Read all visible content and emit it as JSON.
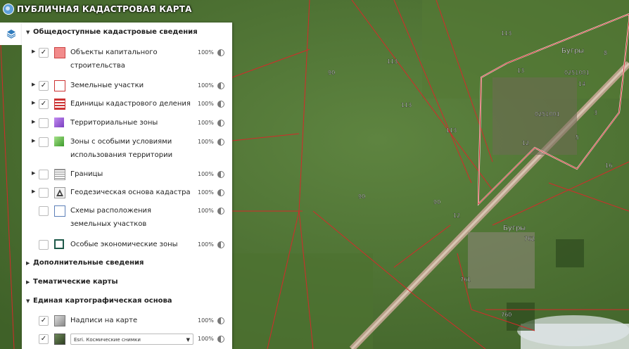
{
  "app": {
    "title": "ПУБЛИЧНАЯ КАДАСТРОВАЯ КАРТА"
  },
  "toolbar": {
    "layers_icon": "layers-icon"
  },
  "panel": {
    "section_main": "Общедоступные кадастровые сведения",
    "layers": [
      {
        "label": "Объекты капитального строительства",
        "checked": true,
        "expandable": true,
        "opacity": "100%"
      },
      {
        "label": "Земельные участки",
        "checked": true,
        "expandable": true,
        "opacity": "100%"
      },
      {
        "label": "Единицы кадастрового деления",
        "checked": true,
        "expandable": true,
        "opacity": "100%"
      },
      {
        "label": "Территориальные зоны",
        "checked": false,
        "expandable": true,
        "opacity": "100%"
      },
      {
        "label": "Зоны с особыми условиями использования территории",
        "checked": false,
        "expandable": true,
        "opacity": "100%"
      },
      {
        "label": "Границы",
        "checked": false,
        "expandable": true,
        "opacity": "100%"
      },
      {
        "label": "Геодезическая основа кадастра",
        "checked": false,
        "expandable": true,
        "opacity": "100%"
      },
      {
        "label": "Схемы расположения земельных участков",
        "checked": false,
        "expandable": false,
        "opacity": "100%"
      },
      {
        "label": "Особые экономические зоны",
        "checked": false,
        "expandable": false,
        "opacity": "100%"
      }
    ],
    "section_extra": "Дополнительные сведения",
    "section_thematic": "Тематические карты",
    "section_base": "Единая картографическая основа",
    "base_layers": [
      {
        "label": "Надписи на карте",
        "checked": true,
        "opacity": "100%"
      },
      {
        "select_value": "Esri. Космические снимки",
        "checked": true,
        "opacity": "100%"
      }
    ]
  },
  "map": {
    "labels": [
      {
        "text": "113"
      },
      {
        "text": "113"
      },
      {
        "text": "90"
      },
      {
        "text": "113"
      },
      {
        "text": "113"
      },
      {
        "text": "90"
      },
      {
        "text": "90"
      },
      {
        "text": "12"
      },
      {
        "text": "Бугры"
      },
      {
        "text": "0251001"
      },
      {
        "text": "Бугры"
      },
      {
        "text": "0251001"
      },
      {
        "text": "762"
      },
      {
        "text": "761"
      },
      {
        "text": "760"
      },
      {
        "text": "16"
      },
      {
        "text": "8"
      },
      {
        "text": "3"
      },
      {
        "text": "5"
      },
      {
        "text": "12"
      },
      {
        "text": "13"
      },
      {
        "text": "14"
      }
    ]
  },
  "colors": {
    "parcel_line": "#d42a2a",
    "panel_bg": "#ffffff",
    "accent": "#5ea0d8"
  }
}
